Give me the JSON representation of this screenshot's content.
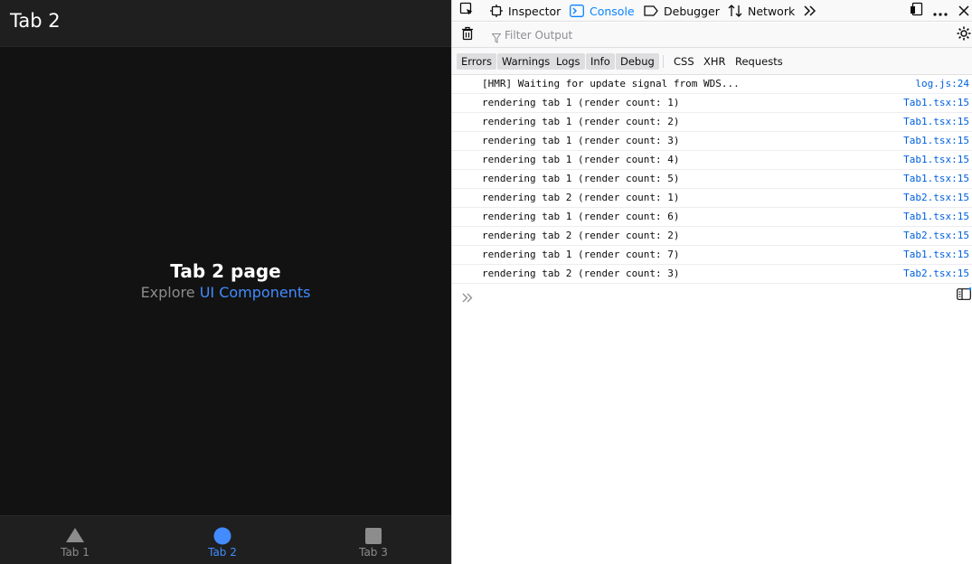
{
  "app": {
    "title": "Tab 2",
    "page_heading": "Tab 2 page",
    "explore_prefix": "Explore ",
    "explore_link": "UI Components",
    "tabs": [
      {
        "label": "Tab 1",
        "icon": "triangle-icon",
        "active": false
      },
      {
        "label": "Tab 2",
        "icon": "ellipse-icon",
        "active": true
      },
      {
        "label": "Tab 3",
        "icon": "square-icon",
        "active": false
      }
    ],
    "colors": {
      "accent": "#428cff",
      "background": "#121212",
      "toolbar": "#1f1f1f",
      "inactive": "#8c8c8c"
    }
  },
  "devtools": {
    "tools": {
      "inspector": "Inspector",
      "console": "Console",
      "debugger": "Debugger",
      "network": "Network"
    },
    "active_tool": "Console",
    "filter_placeholder": "Filter Output",
    "levels": {
      "errors": "Errors",
      "warnings": "Warnings",
      "logs": "Logs",
      "info": "Info",
      "debug": "Debug",
      "css": "CSS",
      "xhr": "XHR",
      "requests": "Requests"
    },
    "messages": [
      {
        "text": "[HMR] Waiting for update signal from WDS...",
        "source": "log.js:24"
      },
      {
        "text": "rendering tab 1 (render count: 1)",
        "source": "Tab1.tsx:15"
      },
      {
        "text": "rendering tab 1 (render count: 2)",
        "source": "Tab1.tsx:15"
      },
      {
        "text": "rendering tab 1 (render count: 3)",
        "source": "Tab1.tsx:15"
      },
      {
        "text": "rendering tab 1 (render count: 4)",
        "source": "Tab1.tsx:15"
      },
      {
        "text": "rendering tab 1 (render count: 5)",
        "source": "Tab1.tsx:15"
      },
      {
        "text": "rendering tab 2 (render count: 1)",
        "source": "Tab2.tsx:15"
      },
      {
        "text": "rendering tab 1 (render count: 6)",
        "source": "Tab1.tsx:15"
      },
      {
        "text": "rendering tab 2 (render count: 2)",
        "source": "Tab2.tsx:15"
      },
      {
        "text": "rendering tab 1 (render count: 7)",
        "source": "Tab1.tsx:15"
      },
      {
        "text": "rendering tab 2 (render count: 3)",
        "source": "Tab2.tsx:15"
      }
    ],
    "colors": {
      "active_tab": "#0a84ff",
      "source_link": "#0060df"
    }
  }
}
